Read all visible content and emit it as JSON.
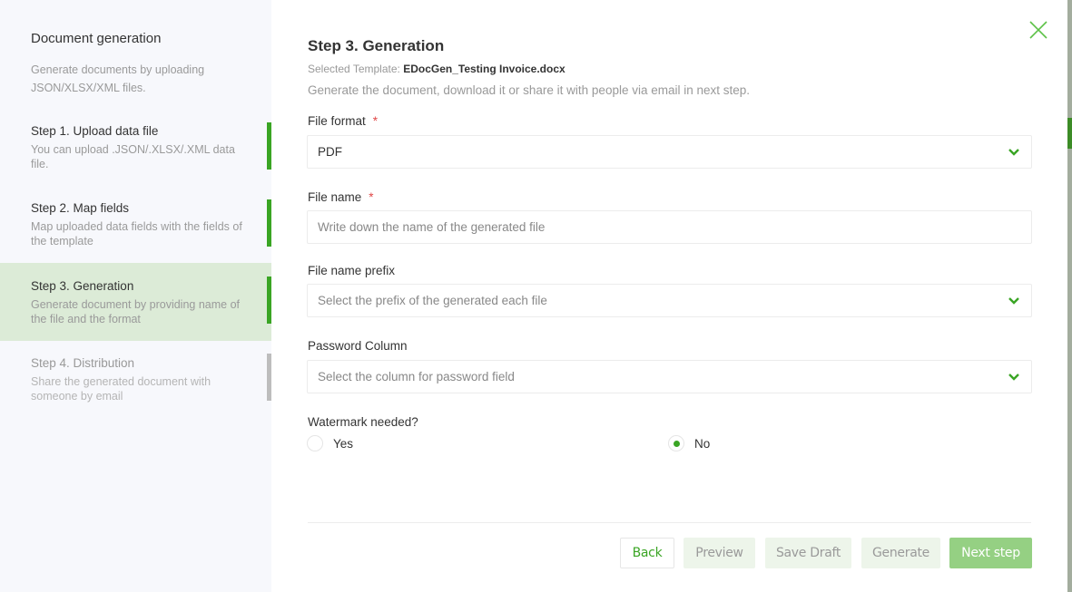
{
  "sidebar": {
    "title": "Document generation",
    "subtitle": "Generate documents by uploading JSON/XLSX/XML files.",
    "steps": [
      {
        "title": "Step 1. Upload data file",
        "desc": "You can upload .JSON/.XLSX/.XML data file.",
        "state": "done"
      },
      {
        "title": "Step 2. Map fields",
        "desc": "Map uploaded data fields with the fields of the template",
        "state": "done"
      },
      {
        "title": "Step 3. Generation",
        "desc": "Generate document by providing name of the file and the format",
        "state": "active"
      },
      {
        "title": "Step 4. Distribution",
        "desc": "Share the generated document with someone by email",
        "state": "pending"
      }
    ]
  },
  "main": {
    "title": "Step 3. Generation",
    "template_label": "Selected Template:",
    "template_name": "EDocGen_Testing Invoice.docx",
    "description": "Generate the document, download it or share it with people via email in next step.",
    "required_mark": "*",
    "file_format": {
      "label": "File format",
      "value": "PDF"
    },
    "file_name": {
      "label": "File name",
      "value": "",
      "placeholder": "Write down the name of the generated file"
    },
    "file_name_prefix": {
      "label": "File name prefix",
      "placeholder": "Select the prefix of the generated each file"
    },
    "password_column": {
      "label": "Password Column",
      "placeholder": "Select the column for password field"
    },
    "watermark": {
      "label": "Watermark needed?",
      "options": [
        "Yes",
        "No"
      ],
      "selected": "No"
    }
  },
  "buttons": {
    "back": "Back",
    "preview": "Preview",
    "save_draft": "Save Draft",
    "generate": "Generate",
    "next_step": "Next step"
  },
  "colors": {
    "accent": "#3aa524",
    "active_step_bg": "#dcebd7",
    "required": "#e04848"
  }
}
